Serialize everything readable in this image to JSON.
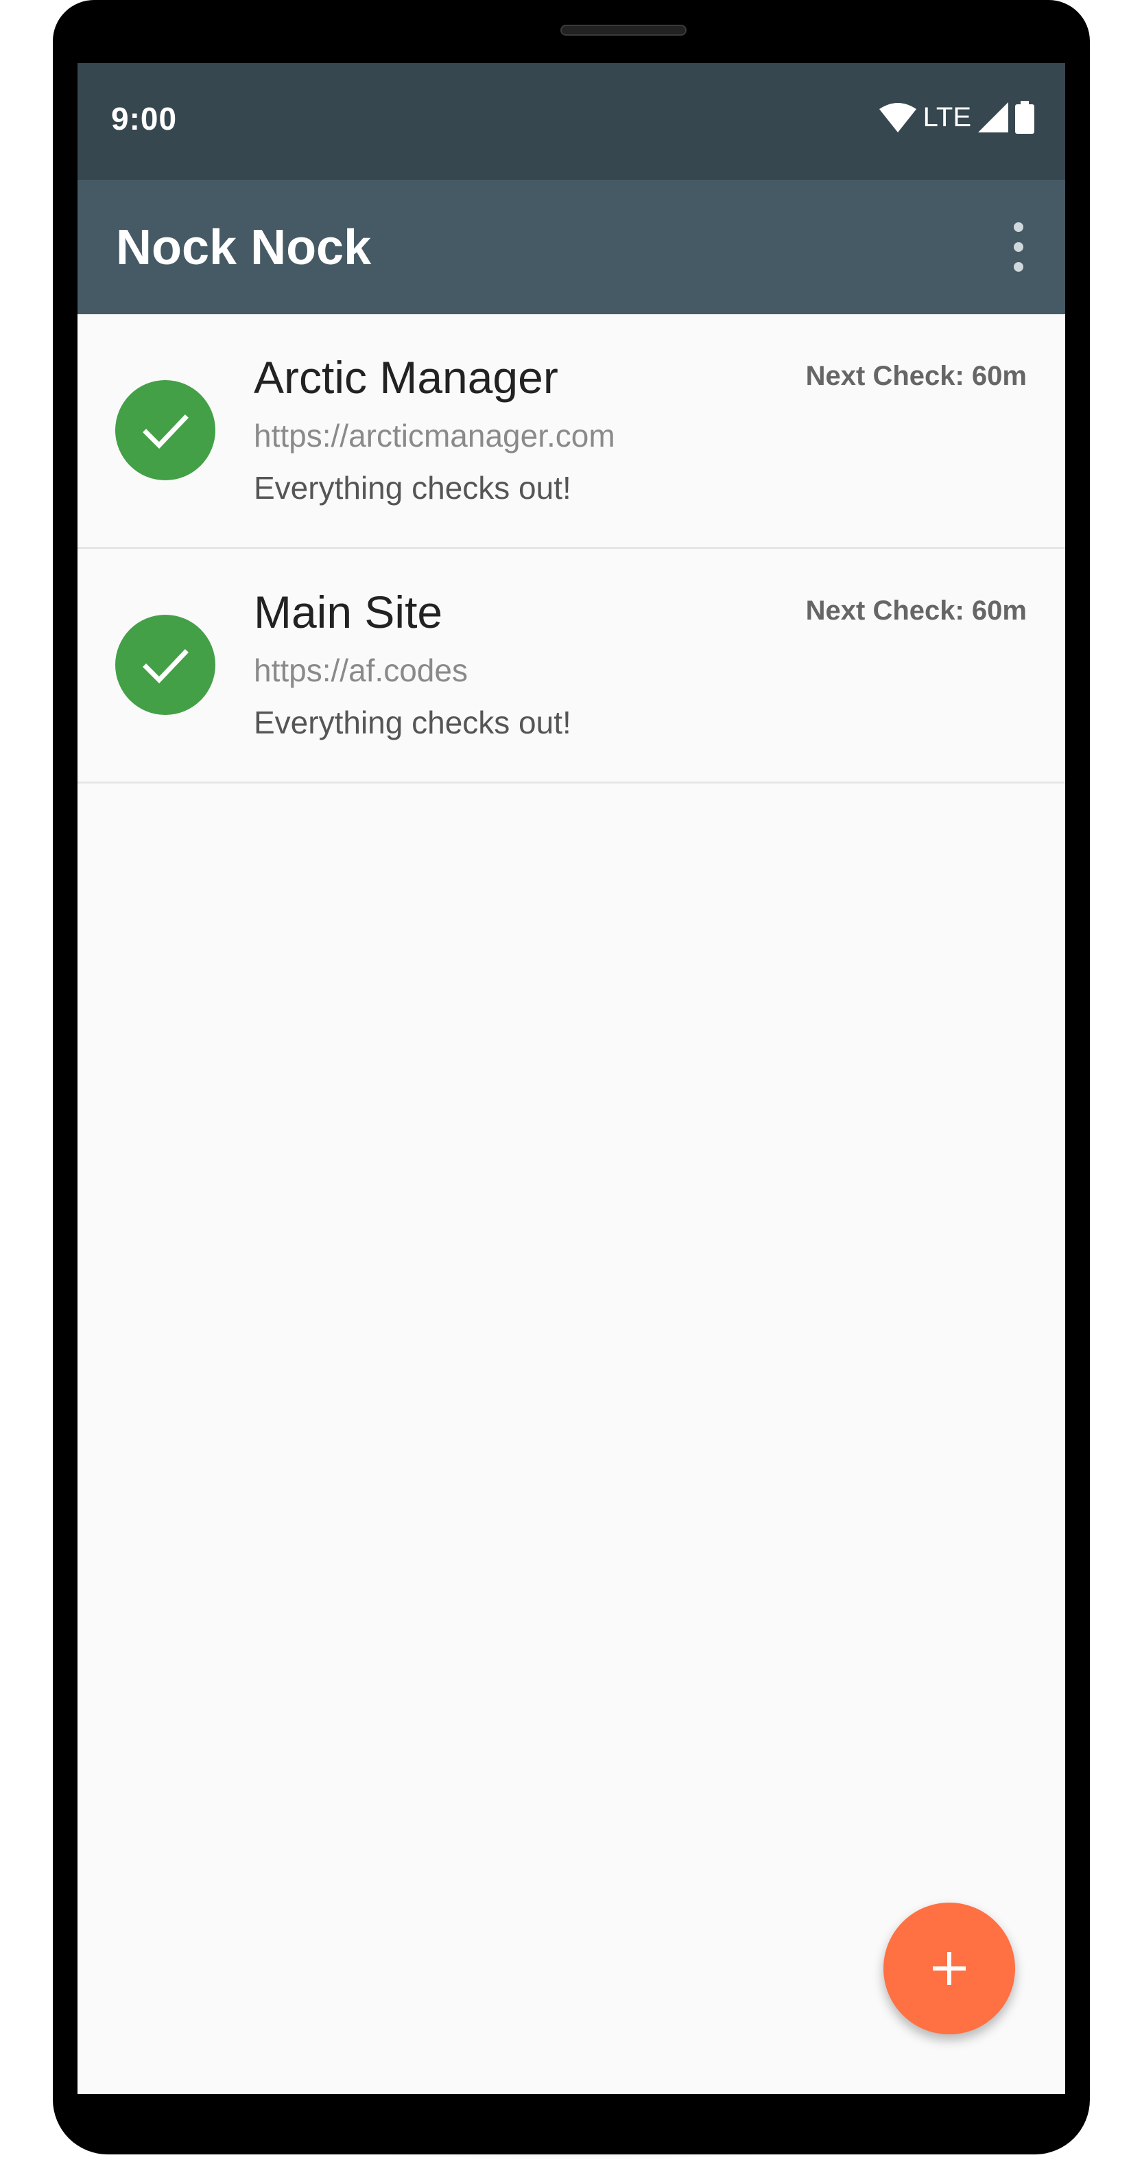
{
  "status_bar": {
    "time": "9:00",
    "network_label": "LTE",
    "icons": [
      "wifi-icon",
      "signal-icon",
      "battery-icon"
    ]
  },
  "app_bar": {
    "title": "Nock Nock",
    "menu_icon": "overflow-menu-icon"
  },
  "sites": [
    {
      "name": "Arctic Manager",
      "url": "https://arcticmanager.com",
      "status": "Everything checks out!",
      "next_check": "Next Check: 60m",
      "status_icon": "check-icon"
    },
    {
      "name": "Main Site",
      "url": "https://af.codes",
      "status": "Everything checks out!",
      "next_check": "Next Check: 60m",
      "status_icon": "check-icon"
    }
  ],
  "fab": {
    "icon": "add-icon"
  },
  "colors": {
    "status_bar": "#37474f",
    "app_bar": "#455a64",
    "ok": "#43a047",
    "fab": "#ff7043",
    "background": "#fafafa"
  }
}
